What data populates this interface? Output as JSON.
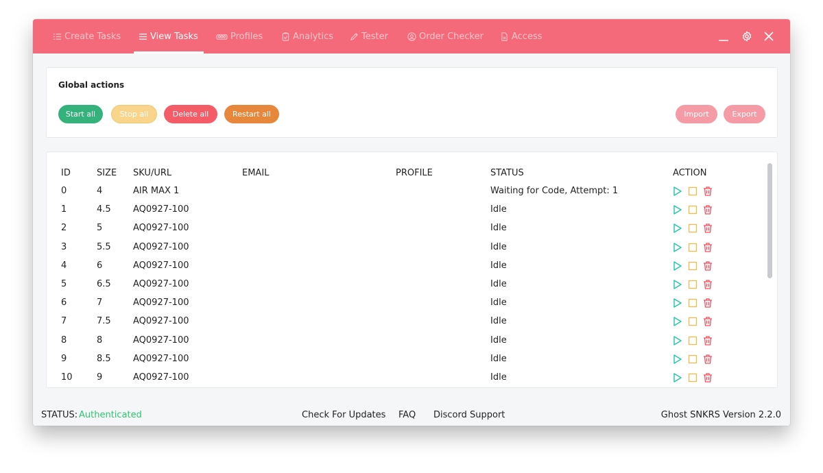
{
  "nav": {
    "tabs": [
      {
        "label": "Create Tasks",
        "icon": "list-icon"
      },
      {
        "label": "View Tasks",
        "icon": "menu-icon"
      },
      {
        "label": "Profiles",
        "icon": "users-icon"
      },
      {
        "label": "Analytics",
        "icon": "clipboard-icon"
      },
      {
        "label": "Tester",
        "icon": "pencil-icon"
      },
      {
        "label": "Order Checker",
        "icon": "user-circle-icon"
      },
      {
        "label": "Access",
        "icon": "file-icon"
      }
    ],
    "active_tab": "View Tasks"
  },
  "global_actions": {
    "title": "Global actions",
    "start_all": "Start all",
    "stop_all": "Stop all",
    "delete_all": "Delete all",
    "restart_all": "Restart all",
    "import": "Import",
    "export": "Export"
  },
  "table": {
    "headers": {
      "id": "ID",
      "size": "SIZE",
      "sku": "SKU/URL",
      "email": "EMAIL",
      "profile": "PROFILE",
      "status": "STATUS",
      "action": "ACTION"
    },
    "rows": [
      {
        "id": "0",
        "size": "4",
        "sku": "AIR MAX 1",
        "email": "",
        "profile": "",
        "status": "Waiting for Code, Attempt: 1"
      },
      {
        "id": "1",
        "size": "4.5",
        "sku": "AQ0927-100",
        "email": "",
        "profile": "",
        "status": "Idle"
      },
      {
        "id": "2",
        "size": "5",
        "sku": "AQ0927-100",
        "email": "",
        "profile": "",
        "status": "Idle"
      },
      {
        "id": "3",
        "size": "5.5",
        "sku": "AQ0927-100",
        "email": "",
        "profile": "",
        "status": "Idle"
      },
      {
        "id": "4",
        "size": "6",
        "sku": "AQ0927-100",
        "email": "",
        "profile": "",
        "status": "Idle"
      },
      {
        "id": "5",
        "size": "6.5",
        "sku": "AQ0927-100",
        "email": "",
        "profile": "",
        "status": "Idle"
      },
      {
        "id": "6",
        "size": "7",
        "sku": "AQ0927-100",
        "email": "",
        "profile": "",
        "status": "Idle"
      },
      {
        "id": "7",
        "size": "7.5",
        "sku": "AQ0927-100",
        "email": "",
        "profile": "",
        "status": "Idle"
      },
      {
        "id": "8",
        "size": "8",
        "sku": "AQ0927-100",
        "email": "",
        "profile": "",
        "status": "Idle"
      },
      {
        "id": "9",
        "size": "8.5",
        "sku": "AQ0927-100",
        "email": "",
        "profile": "",
        "status": "Idle"
      },
      {
        "id": "10",
        "size": "9",
        "sku": "AQ0927-100",
        "email": "",
        "profile": "",
        "status": "Idle"
      }
    ]
  },
  "statusbar": {
    "status_label": "STATUS:",
    "status_value": "Authenticated",
    "check_updates": "Check For Updates",
    "faq": "FAQ",
    "discord": "Discord Support",
    "version": "Ghost SNKRS Version 2.2.0"
  },
  "colors": {
    "header": "#f56a7a",
    "start": "#35b27c",
    "stop": "#f8d58a",
    "delete": "#f45c67",
    "restart": "#e6873b",
    "import_export": "#f59ba6",
    "authenticated": "#2fc56d",
    "play_icon": "#1fc7a3",
    "stop_icon": "#f2b94b",
    "trash_icon": "#f24e5c"
  }
}
